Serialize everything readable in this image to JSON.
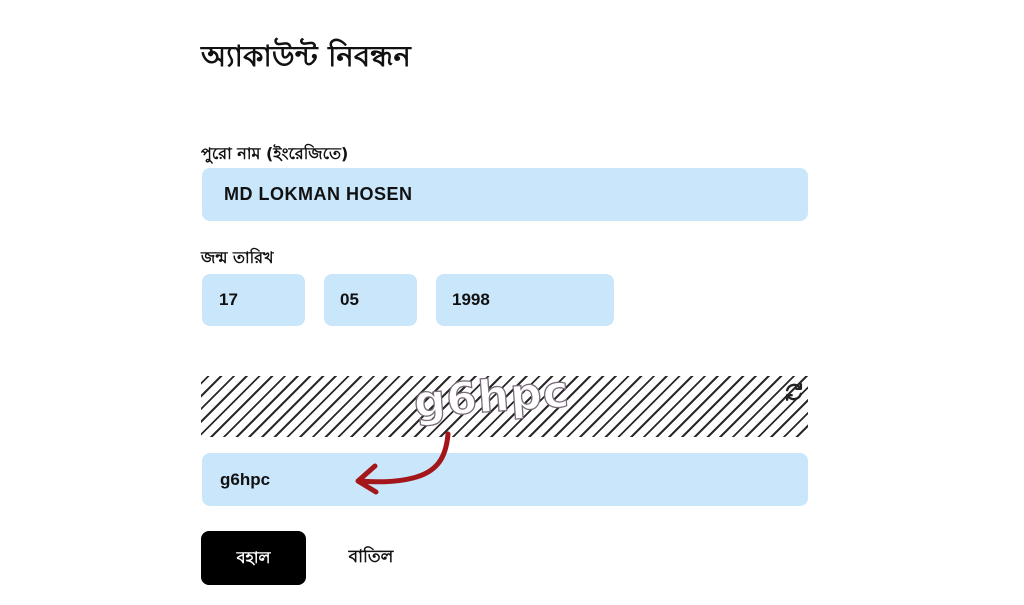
{
  "page": {
    "title": "অ্যাকাউন্ট নিবন্ধন"
  },
  "form": {
    "full_name": {
      "label": "পুরো নাম (ইংরেজিতে)",
      "value": "MD LOKMAN HOSEN"
    },
    "date_of_birth": {
      "label": "জন্ম তারিখ",
      "day": "17",
      "month": "05",
      "year": "1998"
    },
    "captcha": {
      "image_text": "g6hpc",
      "refresh_icon": "refresh-icon",
      "input_value": "g6hpc"
    },
    "actions": {
      "submit_label": "বহাল",
      "cancel_label": "বাতিল"
    }
  },
  "colors": {
    "input_background": "#c9e6fb",
    "submit_background": "#000000",
    "annotation_arrow": "#a3161a"
  }
}
